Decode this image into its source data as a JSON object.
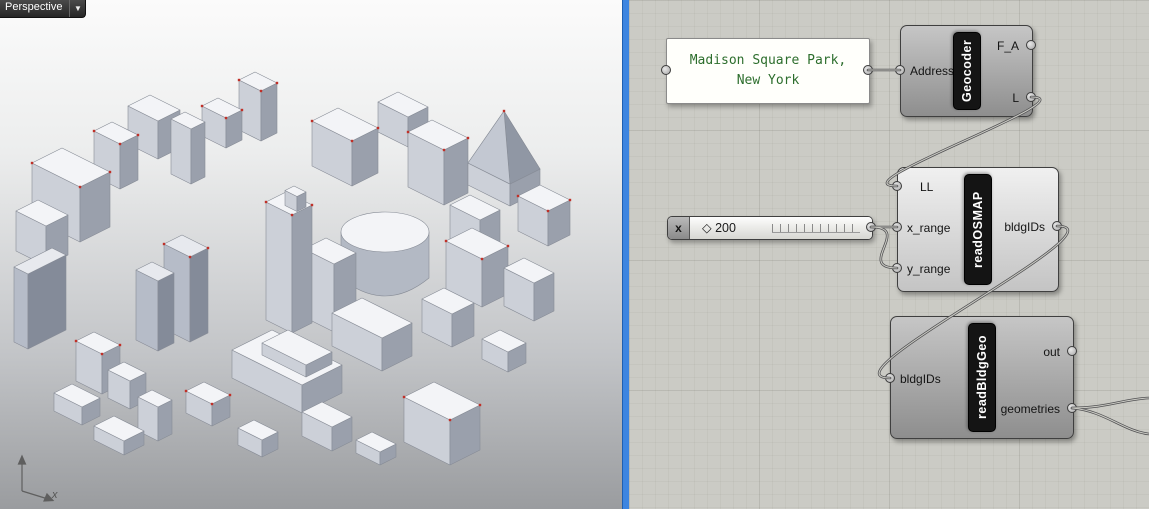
{
  "viewport": {
    "label": "Perspective",
    "menu_icon": "▼",
    "axis_x": "x"
  },
  "canvas": {
    "panel": {
      "line1": "Madison Square Park,",
      "line2": "New York"
    },
    "geocoder": {
      "name": "Geocoder",
      "in_address": "Address",
      "out_fa": "F_A",
      "out_l": "L"
    },
    "slider": {
      "name": "x",
      "marker": "◇",
      "value": "200"
    },
    "readosmap": {
      "name": "readOSMAP",
      "in_ll": "LL",
      "in_xrange": "x_range",
      "in_yrange": "y_range",
      "out_bldgids": "bldgIDs"
    },
    "readbldggeo": {
      "name": "readBldgGeo",
      "in_bldgids": "bldgIDs",
      "out_out": "out",
      "out_geometries": "geometries"
    }
  },
  "colors": {
    "divider_blue": "#3d85e0",
    "wire": "#4f4f51",
    "panel_text_green": "#2d6e2d",
    "capsule_black": "#141414",
    "building_top": "#f3f4f7",
    "building_side_right": "#9aa0ac",
    "building_side_left": "#ccd0d8"
  }
}
